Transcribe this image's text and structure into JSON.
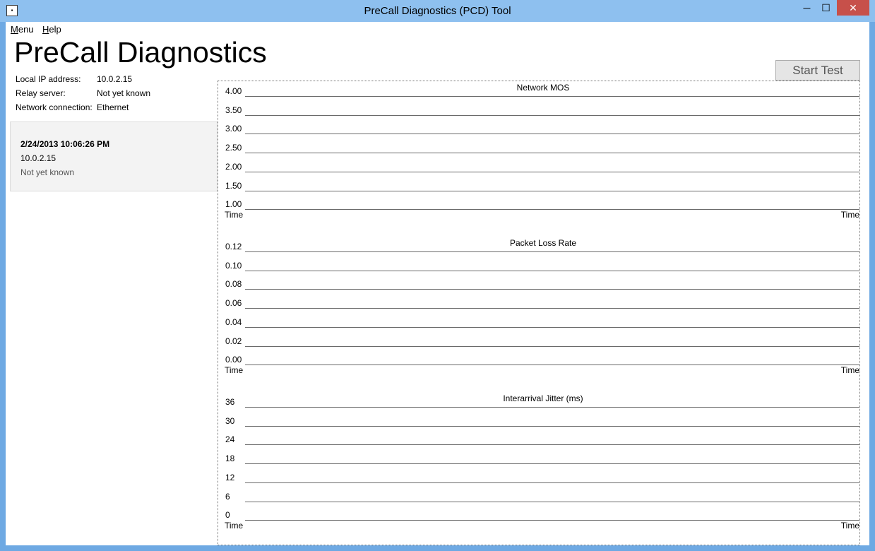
{
  "window": {
    "title": "PreCall Diagnostics (PCD) Tool",
    "minimize_glyph": "─",
    "maximize_glyph": "☐",
    "close_glyph": "✕"
  },
  "menu": {
    "items": [
      {
        "accel": "M",
        "rest": "enu"
      },
      {
        "accel": "H",
        "rest": "elp"
      }
    ]
  },
  "app_title": "PreCall Diagnostics",
  "start_button": "Start Test",
  "info": [
    {
      "label": "Local IP address:",
      "value": "10.0.2.15"
    },
    {
      "label": "Relay server:",
      "value": "Not yet known"
    },
    {
      "label": "Network connection:",
      "value": "Ethernet"
    }
  ],
  "session": {
    "timestamp": "2/24/2013 10:06:26 PM",
    "ip": "10.0.2.15",
    "relay": "Not yet known"
  },
  "chart_data": [
    {
      "type": "line",
      "title": "Network MOS",
      "xlabel": "Time",
      "x_tick_labels": [
        "Time",
        "Time"
      ],
      "y_tick_labels": [
        "4.00",
        "3.50",
        "3.00",
        "2.50",
        "2.00",
        "1.50",
        "1.00"
      ],
      "ylim": [
        1.0,
        4.0
      ],
      "series": [],
      "grid": true
    },
    {
      "type": "line",
      "title": "Packet Loss Rate",
      "xlabel": "Time",
      "x_tick_labels": [
        "Time",
        "Time"
      ],
      "y_tick_labels": [
        "0.12",
        "0.10",
        "0.08",
        "0.06",
        "0.04",
        "0.02",
        "0.00"
      ],
      "ylim": [
        0.0,
        0.12
      ],
      "series": [],
      "grid": true
    },
    {
      "type": "line",
      "title": "Interarrival Jitter (ms)",
      "xlabel": "Time",
      "x_tick_labels": [
        "Time",
        "Time"
      ],
      "y_tick_labels": [
        "36",
        "30",
        "24",
        "18",
        "12",
        "6",
        "0"
      ],
      "ylim": [
        0,
        36
      ],
      "series": [],
      "grid": true
    }
  ]
}
